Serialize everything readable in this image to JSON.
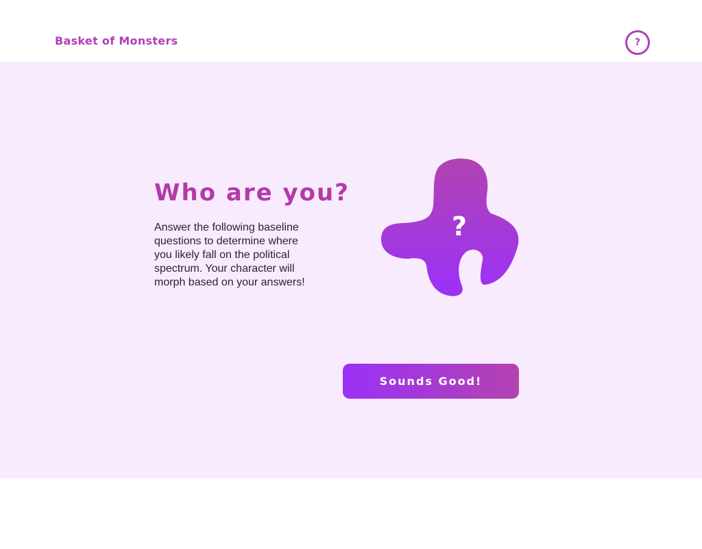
{
  "header": {
    "app_title": "Basket of Monsters",
    "help_label": "?"
  },
  "main": {
    "title": "Who are you?",
    "description": "Answer the following baseline questions to determine where you likely fall on the political spectrum.  Your character will morph based on your answers!",
    "monster_placeholder": "?",
    "cta_label": "Sounds Good!"
  },
  "colors": {
    "brand": "#b23fb5",
    "background_panel": "#f8ebfd",
    "gradient_start": "#9a31f6",
    "gradient_end": "#b343b0"
  },
  "icons": {
    "help": "question-circle-icon",
    "monster": "blob-monster-icon"
  }
}
